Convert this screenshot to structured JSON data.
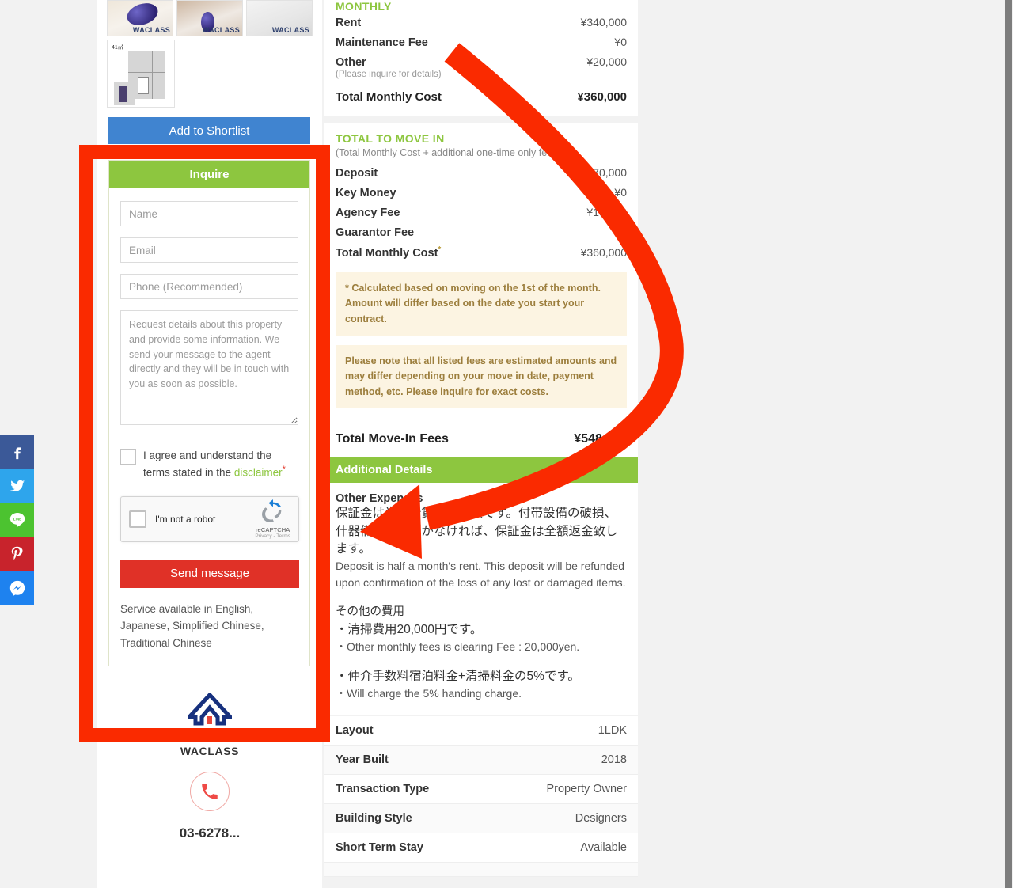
{
  "social": {
    "items": [
      {
        "name": "facebook",
        "icon": "facebook-icon",
        "color": "#3b5998"
      },
      {
        "name": "twitter",
        "icon": "twitter-icon",
        "color": "#2ea5ec"
      },
      {
        "name": "line",
        "icon": "line-icon",
        "color": "#4cc330",
        "label": "LINE"
      },
      {
        "name": "pinterest",
        "icon": "pinterest-icon",
        "color": "#c8232c"
      },
      {
        "name": "messenger",
        "icon": "messenger-icon",
        "color": "#1e82ef"
      }
    ]
  },
  "gallery": {
    "watermark": "WACLASS",
    "floorplan_label": "41㎡"
  },
  "sidebar": {
    "shortlist_button": "Add to Shortlist",
    "inquire": {
      "title": "Inquire",
      "name_placeholder": "Name",
      "email_placeholder": "Email",
      "phone_placeholder": "Phone (Recommended)",
      "message_placeholder": "Request details about this property and provide some information. We send your message to the agent directly and they will be in touch with you as soon as possible.",
      "agree_text_before": "I agree and understand the terms stated in the ",
      "agree_link": "disclaimer",
      "agree_required_mark": "*",
      "recaptcha_label": "I'm not a robot",
      "recaptcha_brand": "reCAPTCHA",
      "recaptcha_terms": "Privacy - Terms",
      "send_button": "Send message",
      "service_note": "Service available in English, Japanese, Simplified Chinese, Traditional Chinese"
    },
    "agent": {
      "name": "WACLASS",
      "phone": "03-6278..."
    }
  },
  "main": {
    "monthly": {
      "title": "MONTHLY",
      "rows": [
        {
          "label": "Rent",
          "value": "¥340,000"
        },
        {
          "label": "Maintenance Fee",
          "value": "¥0"
        },
        {
          "label": "Other",
          "value": "¥20,000",
          "note": "(Please inquire for details)"
        }
      ],
      "total_label": "Total Monthly Cost",
      "total_value": "¥360,000"
    },
    "move_in": {
      "title": "TOTAL TO MOVE IN",
      "subtitle": "(Total Monthly Cost + additional one-time only fees)",
      "rows": [
        {
          "label": "Deposit",
          "value": "¥170,000"
        },
        {
          "label": "Key Money",
          "value": "¥0"
        },
        {
          "label": "Agency Fee",
          "value": "¥18,000"
        },
        {
          "label": "Guarantor Fee",
          "value": "¥0"
        },
        {
          "label": "Total Monthly Cost",
          "value": "¥360,000",
          "sup": "*"
        }
      ],
      "callout_1": "* Calculated based on moving on the 1st of the month. Amount will differ based on the date you start your contract.",
      "callout_2": "Please note that all listed fees are estimated amounts and may differ depending on your move in date, payment method, etc. Please inquire for exact costs.",
      "total_label": "Total Move-In Fees",
      "total_value": "¥548,000"
    },
    "additional": {
      "title": "Additional Details",
      "other_expenses_label": "Other Expenses",
      "jp_deposit": "保証金は半月分賃料の金額です。付帯設備の破損、什器備品の問題がなければ、保証金は全額返金致します。",
      "en_deposit": "Deposit is half a month's rent. This deposit will be refunded upon confirmation of the loss of any lost or damaged items.",
      "jp_other_title": "その他の費用",
      "jp_cleaning": "・清掃費用20,000円です。",
      "en_cleaning": "・Other monthly fees is clearing Fee : 20,000yen.",
      "jp_handling": "・仲介手数料宿泊料金+清掃料金の5%です。",
      "en_handling": "・Will charge the 5% handing charge."
    },
    "property_table": [
      {
        "key": "Layout",
        "value": "1LDK"
      },
      {
        "key": "Year Built",
        "value": "2018"
      },
      {
        "key": "Transaction Type",
        "value": "Property Owner"
      },
      {
        "key": "Building Style",
        "value": "Designers"
      },
      {
        "key": "Short Term Stay",
        "value": "Available"
      }
    ]
  },
  "annotation": {
    "highlight_color": "#fa2a00",
    "arrow_color": "#fa2a00"
  }
}
